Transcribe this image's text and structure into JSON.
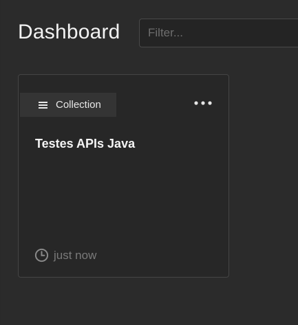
{
  "header": {
    "title": "Dashboard",
    "filter_placeholder": "Filter..."
  },
  "card": {
    "type_label": "Collection",
    "type_icon": "list-icon",
    "title": "Testes APIs Java",
    "updated_icon": "clock-icon",
    "updated_text": "just now",
    "menu_icon": "more-horizontal-icon"
  },
  "colors": {
    "background": "#2b2b2b",
    "card_background": "#272727",
    "card_border": "#454545",
    "badge_background": "#343434",
    "muted_text": "#7a7a7a"
  }
}
